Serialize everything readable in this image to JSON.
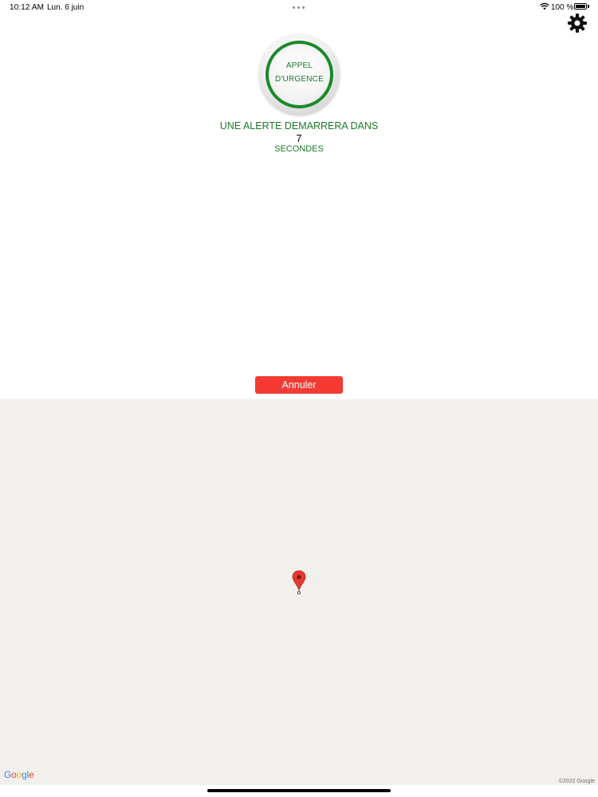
{
  "status_bar": {
    "time": "10:12 AM",
    "date": "Lun. 6 juin",
    "battery_text": "100 %",
    "wifi_icon": "wifi-icon",
    "battery_icon": "battery-icon"
  },
  "settings": {
    "icon": "gear-icon"
  },
  "emergency": {
    "line1": "APPEL",
    "line2": "D'URGENCE",
    "accent_color": "#1b8a2a"
  },
  "alert": {
    "title": "UNE ALERTE DEMARRERA DANS",
    "countdown": "7",
    "unit": "SECONDES"
  },
  "cancel": {
    "label": "Annuler",
    "color": "#f43a33"
  },
  "map": {
    "pin_icon": "map-pin-icon",
    "logo": "Google",
    "copyright": "©2022 Google"
  }
}
